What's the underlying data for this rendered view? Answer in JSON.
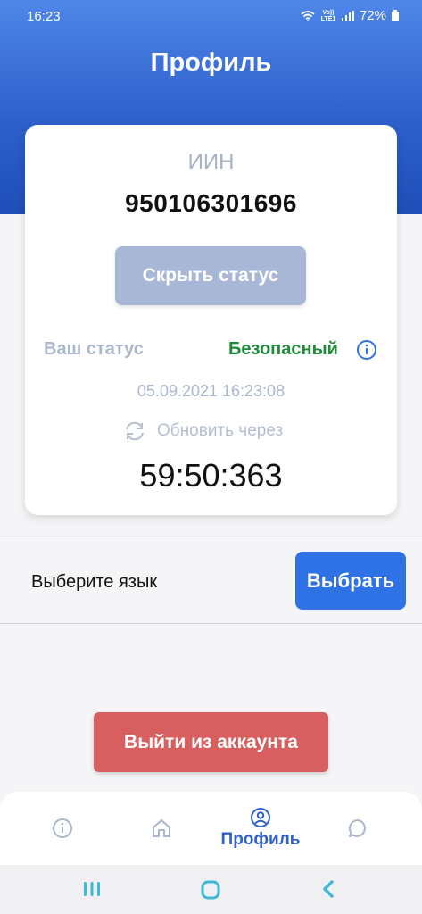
{
  "status_bar": {
    "time": "16:23",
    "network": "Vo)) LTE1",
    "battery": "72%"
  },
  "header": {
    "title": "Профиль"
  },
  "card": {
    "iin_label": "ИИН",
    "iin_value": "950106301696",
    "hide_button": "Скрыть статус",
    "status_label": "Ваш статус",
    "status_value": "Безопасный",
    "datetime": "05.09.2021 16:23:08",
    "refresh_label": "Обновить через",
    "timer": "59:50:363"
  },
  "language": {
    "label": "Выберите язык",
    "button": "Выбрать"
  },
  "logout_button": "Выйти из аккаунта",
  "bottom_nav": {
    "items": [
      {
        "icon": "info-icon",
        "label": ""
      },
      {
        "icon": "home-icon",
        "label": ""
      },
      {
        "icon": "profile-icon",
        "label": "Профиль",
        "active": true
      },
      {
        "icon": "chat-icon",
        "label": ""
      }
    ]
  },
  "colors": {
    "primary": "#2f72e6",
    "header": "#2e61cc",
    "safe_status": "#1f8a3c",
    "logout": "#d85f5f",
    "muted": "#a9b6cc"
  }
}
